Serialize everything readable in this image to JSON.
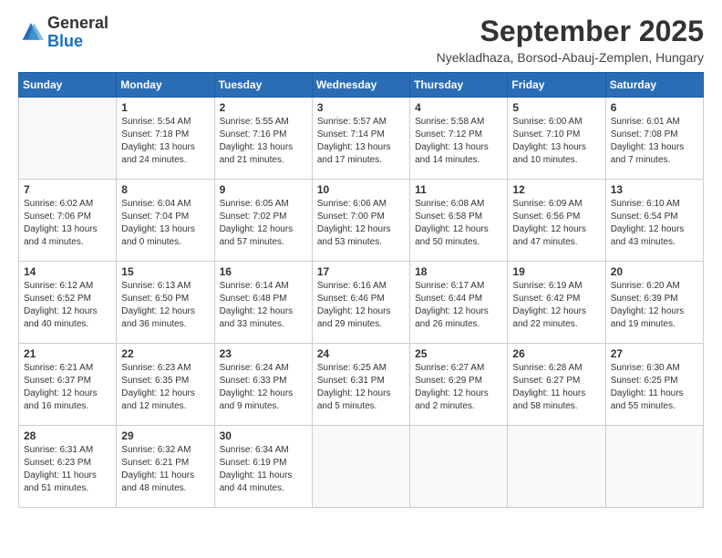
{
  "logo": {
    "general": "General",
    "blue": "Blue"
  },
  "title": "September 2025",
  "subtitle": "Nyekladhaza, Borsod-Abauj-Zemplen, Hungary",
  "weekdays": [
    "Sunday",
    "Monday",
    "Tuesday",
    "Wednesday",
    "Thursday",
    "Friday",
    "Saturday"
  ],
  "weeks": [
    [
      {
        "day": "",
        "info": ""
      },
      {
        "day": "1",
        "info": "Sunrise: 5:54 AM\nSunset: 7:18 PM\nDaylight: 13 hours\nand 24 minutes."
      },
      {
        "day": "2",
        "info": "Sunrise: 5:55 AM\nSunset: 7:16 PM\nDaylight: 13 hours\nand 21 minutes."
      },
      {
        "day": "3",
        "info": "Sunrise: 5:57 AM\nSunset: 7:14 PM\nDaylight: 13 hours\nand 17 minutes."
      },
      {
        "day": "4",
        "info": "Sunrise: 5:58 AM\nSunset: 7:12 PM\nDaylight: 13 hours\nand 14 minutes."
      },
      {
        "day": "5",
        "info": "Sunrise: 6:00 AM\nSunset: 7:10 PM\nDaylight: 13 hours\nand 10 minutes."
      },
      {
        "day": "6",
        "info": "Sunrise: 6:01 AM\nSunset: 7:08 PM\nDaylight: 13 hours\nand 7 minutes."
      }
    ],
    [
      {
        "day": "7",
        "info": "Sunrise: 6:02 AM\nSunset: 7:06 PM\nDaylight: 13 hours\nand 4 minutes."
      },
      {
        "day": "8",
        "info": "Sunrise: 6:04 AM\nSunset: 7:04 PM\nDaylight: 13 hours\nand 0 minutes."
      },
      {
        "day": "9",
        "info": "Sunrise: 6:05 AM\nSunset: 7:02 PM\nDaylight: 12 hours\nand 57 minutes."
      },
      {
        "day": "10",
        "info": "Sunrise: 6:06 AM\nSunset: 7:00 PM\nDaylight: 12 hours\nand 53 minutes."
      },
      {
        "day": "11",
        "info": "Sunrise: 6:08 AM\nSunset: 6:58 PM\nDaylight: 12 hours\nand 50 minutes."
      },
      {
        "day": "12",
        "info": "Sunrise: 6:09 AM\nSunset: 6:56 PM\nDaylight: 12 hours\nand 47 minutes."
      },
      {
        "day": "13",
        "info": "Sunrise: 6:10 AM\nSunset: 6:54 PM\nDaylight: 12 hours\nand 43 minutes."
      }
    ],
    [
      {
        "day": "14",
        "info": "Sunrise: 6:12 AM\nSunset: 6:52 PM\nDaylight: 12 hours\nand 40 minutes."
      },
      {
        "day": "15",
        "info": "Sunrise: 6:13 AM\nSunset: 6:50 PM\nDaylight: 12 hours\nand 36 minutes."
      },
      {
        "day": "16",
        "info": "Sunrise: 6:14 AM\nSunset: 6:48 PM\nDaylight: 12 hours\nand 33 minutes."
      },
      {
        "day": "17",
        "info": "Sunrise: 6:16 AM\nSunset: 6:46 PM\nDaylight: 12 hours\nand 29 minutes."
      },
      {
        "day": "18",
        "info": "Sunrise: 6:17 AM\nSunset: 6:44 PM\nDaylight: 12 hours\nand 26 minutes."
      },
      {
        "day": "19",
        "info": "Sunrise: 6:19 AM\nSunset: 6:42 PM\nDaylight: 12 hours\nand 22 minutes."
      },
      {
        "day": "20",
        "info": "Sunrise: 6:20 AM\nSunset: 6:39 PM\nDaylight: 12 hours\nand 19 minutes."
      }
    ],
    [
      {
        "day": "21",
        "info": "Sunrise: 6:21 AM\nSunset: 6:37 PM\nDaylight: 12 hours\nand 16 minutes."
      },
      {
        "day": "22",
        "info": "Sunrise: 6:23 AM\nSunset: 6:35 PM\nDaylight: 12 hours\nand 12 minutes."
      },
      {
        "day": "23",
        "info": "Sunrise: 6:24 AM\nSunset: 6:33 PM\nDaylight: 12 hours\nand 9 minutes."
      },
      {
        "day": "24",
        "info": "Sunrise: 6:25 AM\nSunset: 6:31 PM\nDaylight: 12 hours\nand 5 minutes."
      },
      {
        "day": "25",
        "info": "Sunrise: 6:27 AM\nSunset: 6:29 PM\nDaylight: 12 hours\nand 2 minutes."
      },
      {
        "day": "26",
        "info": "Sunrise: 6:28 AM\nSunset: 6:27 PM\nDaylight: 11 hours\nand 58 minutes."
      },
      {
        "day": "27",
        "info": "Sunrise: 6:30 AM\nSunset: 6:25 PM\nDaylight: 11 hours\nand 55 minutes."
      }
    ],
    [
      {
        "day": "28",
        "info": "Sunrise: 6:31 AM\nSunset: 6:23 PM\nDaylight: 11 hours\nand 51 minutes."
      },
      {
        "day": "29",
        "info": "Sunrise: 6:32 AM\nSunset: 6:21 PM\nDaylight: 11 hours\nand 48 minutes."
      },
      {
        "day": "30",
        "info": "Sunrise: 6:34 AM\nSunset: 6:19 PM\nDaylight: 11 hours\nand 44 minutes."
      },
      {
        "day": "",
        "info": ""
      },
      {
        "day": "",
        "info": ""
      },
      {
        "day": "",
        "info": ""
      },
      {
        "day": "",
        "info": ""
      }
    ]
  ]
}
